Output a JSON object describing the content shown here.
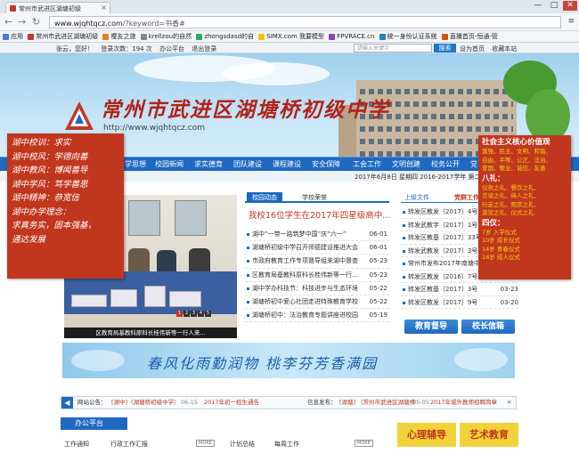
{
  "browser": {
    "tab_title": "常州市武进区湖塘初级",
    "window_buttons": [
      "—",
      "□",
      "✕"
    ],
    "url_host": "www.wjqhtqcz.com",
    "url_path": "/?keyword=书香#",
    "bookmarks": [
      {
        "label": "应用",
        "color": "#4a7bd1"
      },
      {
        "label": "常州市武进区湖塘初级",
        "color": "#c0392b"
      },
      {
        "label": "樱友之旅",
        "color": "#e67e22"
      },
      {
        "label": "krellzou的自然",
        "color": "#888888"
      },
      {
        "label": "zhongsdasd的自",
        "color": "#27ae60"
      },
      {
        "label": "SIMX.com 我要模型",
        "color": "#f1c40f"
      },
      {
        "label": "FPVRACE.cn",
        "color": "#8e44ad"
      },
      {
        "label": "统一身份认证系统",
        "color": "#2980b9"
      },
      {
        "label": "直播首页-恒通-管",
        "color": "#d35400"
      }
    ]
  },
  "topline": {
    "greeting": "张云，您好！",
    "visits": "登录次数：194 次",
    "office": "办公平台",
    "logout": "退出登录",
    "search_placeholder": "请输入关键字",
    "search_btn": "搜索",
    "homepage": "设为首页",
    "favorite": "收藏本站"
  },
  "banner": {
    "school_name": "常州市武进区湖塘桥初级中学",
    "url": "http://www.wjqhtqcz.com",
    "left_motto": [
      "湖中校训：求实",
      "湖中校风：学德向善",
      "湖中教风：博闻善导",
      "湖中学风：笃学善思",
      "湖中精神：恭宽信",
      "湖中办学理念：",
      "求真务实，固本强基，",
      "通达发展"
    ],
    "right_title": "社会主义核心价值观",
    "right_values": [
      "富强、民主、文明、和谐、",
      "自由、平等、公正、法治、",
      "爱国、敬业、诚信、友善"
    ],
    "right_sub1": "八礼：",
    "right_eight": [
      "仪表之礼、餐饮之礼、",
      "言谈之礼、待人之礼、",
      "行走之礼、观赏之礼、",
      "游览之礼、仪式之礼"
    ],
    "right_sub2": "四仪：",
    "right_four": [
      "7岁 入学仪式",
      "10岁 成长仪式",
      "14岁 青春仪式",
      "18岁 成人仪式"
    ]
  },
  "menu": [
    "学思想",
    "校园新闻",
    "求实德育",
    "团队建设",
    "课程建设",
    "安全保障",
    "工会工作",
    "文明创建",
    "校务公开",
    "党"
  ],
  "datebar": "2017年6月8日 星期四 2016-2017学年 第二",
  "photo_caption": "区教育局基教科原科长桂伟新等一行人来...",
  "photo_dots": [
    "1",
    "2",
    "3",
    "4",
    "5"
  ],
  "news": {
    "tab_active": "校园动态",
    "tab_inactive": "学校荣誉",
    "headline": "我校16位学生在2017年四星级高中...",
    "items": [
      {
        "title": "湖中“一带一路筑梦中国”庆“六一”",
        "date": "06-01"
      },
      {
        "title": "湖塘桥初级中学召开师德建设推进大会",
        "date": "06-01"
      },
      {
        "title": "市政府教育工作专项督导组来湖中督查",
        "date": "05-23"
      },
      {
        "title": "区教育局基教科原科长桂伟新等一行...",
        "date": "05-23"
      },
      {
        "title": "湖中学办科技节：科技进步与生态环境",
        "date": "05-22"
      },
      {
        "title": "湖塘桥初中爱心社团走进特殊教育学校",
        "date": "05-22"
      },
      {
        "title": "湖塘桥初中：法治教育专题讲座进校园",
        "date": "05-19"
      }
    ]
  },
  "files": {
    "tab1": "上级文件",
    "tab2": "党群工作",
    "tab2_more": "专",
    "items": [
      {
        "title": "转发区教发〔2017〕4号",
        "date": ""
      },
      {
        "title": "转发武教字〔2017〕1号",
        "date": ""
      },
      {
        "title": "转发区教基〔2017〕33号",
        "date": ""
      },
      {
        "title": "转发武教发〔2017〕3号",
        "date": ""
      },
      {
        "title": "常州市发布2017年南塘中考",
        "date": ""
      },
      {
        "title": "转发区教发〔2016〕7号",
        "date": ""
      },
      {
        "title": "转发区教基〔2017〕3号",
        "date": "03-23"
      },
      {
        "title": "转发区教发〔2017〕9号",
        "date": "03-20"
      }
    ],
    "btn1": "教育督导",
    "btn2": "校长信箱"
  },
  "slogan": "春风化雨勤润物  桃李芬芳香满园",
  "ticker": {
    "label": "网站公告：",
    "item1": "[湖中]（湖塘桥初级中学）",
    "date1": "06-15",
    "item2": "2017年初一招生通告",
    "label2": "信息发布：",
    "item3": "[湖塘] （常州市武进区湖塘桥",
    "date3": "05-05",
    "item4": "2017年城外教师招聘简章",
    "close": "✕"
  },
  "office": {
    "title": "办公平台",
    "items": [
      "工作通知",
      "行政工作汇报",
      "MORE",
      "计划总结",
      "每周工作",
      "MORE"
    ]
  },
  "promos": [
    "心理辅导",
    "艺术教育"
  ]
}
